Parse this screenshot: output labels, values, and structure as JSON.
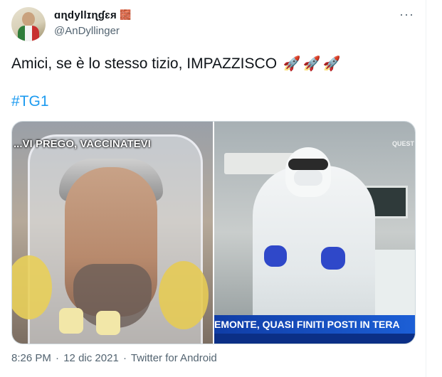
{
  "author": {
    "display_name": "ɑɳdyllɪɳɠɛя",
    "brick_emoji": "🧱",
    "handle": "@AnDyllinger"
  },
  "tweet": {
    "text": "Amici, se è lo stesso tizio, IMPAZZISCO",
    "emoji": [
      "🚀",
      "🚀",
      "🚀"
    ],
    "hashtag": "#TG1"
  },
  "media": {
    "left_overlay": "...VI PREGO, VACCINATEVI",
    "right_channel": "QUEST",
    "right_ticker": "EMONTE, QUASI FINITI POSTI IN TERA"
  },
  "meta": {
    "time": "8:26 PM",
    "separator": "·",
    "date": "12 dic 2021",
    "source": "Twitter for Android"
  },
  "menu": {
    "more_icon": "···"
  },
  "colors": {
    "link": "#1d9bf0",
    "muted": "#536471",
    "text": "#0f1419",
    "ticker": "#1c5fd6"
  },
  "icons": {
    "more": "more-horizontal-icon",
    "avatar": "user-avatar"
  }
}
